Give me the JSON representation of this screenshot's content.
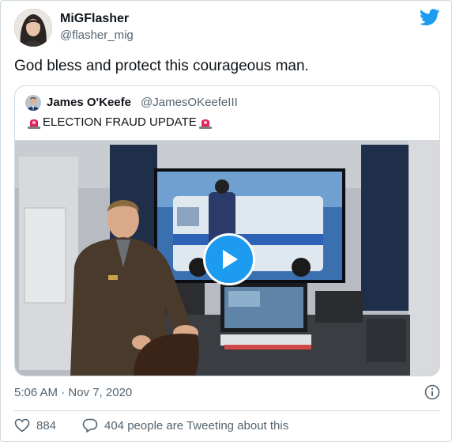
{
  "author": {
    "display_name": "MiGFlasher",
    "handle": "@flasher_mig",
    "avatar_icon": "profile-photo"
  },
  "tweet": {
    "text": "God bless and protect this courageous man."
  },
  "quoted": {
    "display_name": "James O'Keefe",
    "handle": "@JamesOKeefeIII",
    "text": "ELECTION FRAUD UPDATE",
    "emoji_icon": "rotating-light-icon"
  },
  "video": {
    "play_icon": "play-icon"
  },
  "footer": {
    "timestamp": "5:06 AM · Nov 7, 2020",
    "like_count": "884",
    "reply_text": "404 people are Tweeting about this"
  },
  "colors": {
    "accent": "#1d9bf0",
    "text_secondary": "#536471",
    "border": "#cfd9de"
  }
}
